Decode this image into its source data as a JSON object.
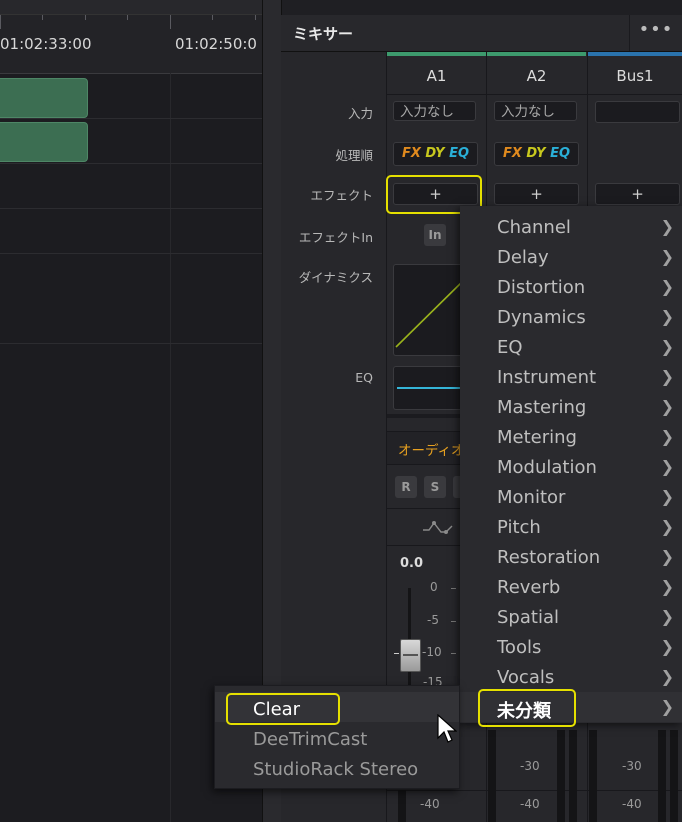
{
  "timeline": {
    "timecodes": [
      "01:02:33:00",
      "01:02:50:0"
    ]
  },
  "mixer": {
    "title": "ミキサー",
    "more_icon": "more-horizontal-icon",
    "columns": [
      {
        "label": "A1",
        "color": "#3d9a6d"
      },
      {
        "label": "A2",
        "color": "#3d9a6d"
      },
      {
        "label": "Bus1",
        "color": "#2a73ad"
      }
    ],
    "rows": {
      "input": "入力",
      "order": "処理順",
      "effects": "エフェクト",
      "effects_in": "エフェクトIn",
      "dynamics": "ダイナミクス",
      "eq": "EQ"
    },
    "input_values": [
      "入力なし",
      "入力なし",
      ""
    ],
    "order_chips": {
      "fx": "FX",
      "dy": "DY",
      "eq": "EQ"
    },
    "add_effect_label": "+",
    "effects_in_label": "In",
    "audio_label": "オーディオ",
    "track_buttons": {
      "r": "R",
      "s": "S"
    },
    "fader": {
      "value": "0.0",
      "scale": [
        "0",
        "-5",
        "-10",
        "-15"
      ],
      "meter_labels": [
        "-30",
        "-40"
      ]
    }
  },
  "effects_menu": {
    "items": [
      "Channel",
      "Delay",
      "Distortion",
      "Dynamics",
      "EQ",
      "Instrument",
      "Mastering",
      "Metering",
      "Modulation",
      "Monitor",
      "Pitch",
      "Restoration",
      "Reverb",
      "Spatial",
      "Tools",
      "Vocals",
      "未分類"
    ],
    "selected": "未分類"
  },
  "uncategorized_menu": {
    "items": [
      "Clear",
      "DeeTrimCast",
      "StudioRack Stereo"
    ],
    "highlighted": "Clear"
  },
  "colors": {
    "highlight": "#e5e000",
    "fx": "#e08a1e",
    "dy": "#c8c81e",
    "eq_chip": "#2ab0d8",
    "clip": "#3c6e52",
    "audio_label": "#e6a020",
    "eq_curve": "#35b5d8",
    "dyn_curve": "#9ab31c"
  }
}
